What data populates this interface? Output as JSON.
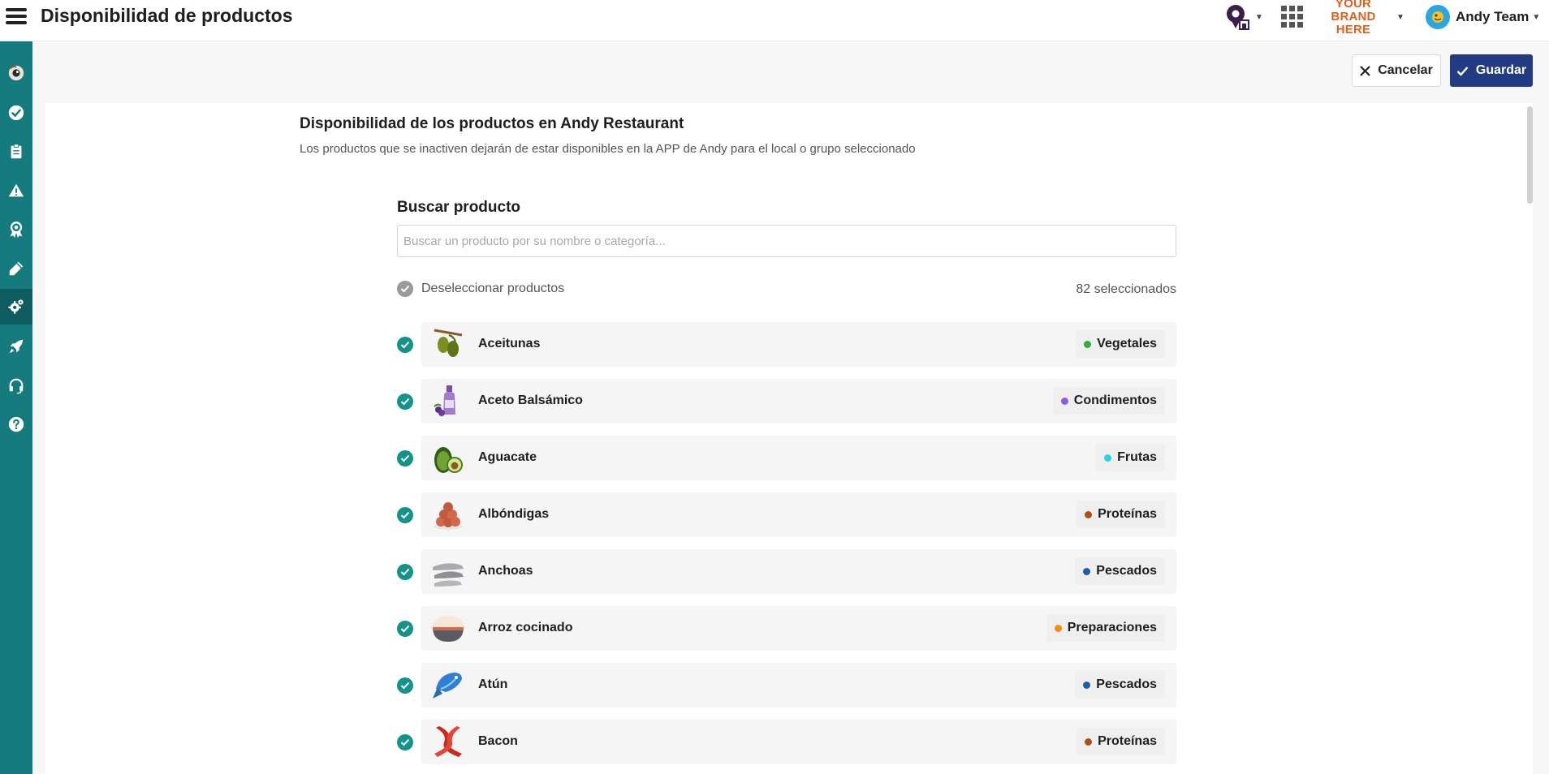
{
  "header": {
    "title": "Disponibilidad de productos",
    "brand_line1": "YOUR BRAND",
    "brand_line2": "HERE",
    "user_name": "Andy Team"
  },
  "actions": {
    "cancel_label": "Cancelar",
    "save_label": "Guardar"
  },
  "section": {
    "title": "Disponibilidad de los productos en Andy Restaurant",
    "subtitle": "Los productos que se inactiven dejarán de estar disponibles en la APP de Andy para el local o grupo seleccionado"
  },
  "search": {
    "label": "Buscar producto",
    "placeholder": "Buscar un producto por su nombre o categoría...",
    "value": ""
  },
  "selection": {
    "deselect_label": "Deseleccionar productos",
    "count_label": "82 seleccionados"
  },
  "sidebar": {
    "items": [
      "eye-logo-icon",
      "check-circle-icon",
      "clipboard-icon",
      "warning-icon",
      "award-icon",
      "pencil-icon",
      "gears-icon",
      "rocket-icon",
      "headset-icon",
      "help-icon"
    ],
    "active_item": "gears-icon"
  },
  "colors": {
    "sidebar": "#157b7e",
    "save_button": "#233b82",
    "check": "#14938a",
    "brand": "#e0611b"
  },
  "products": [
    {
      "name": "Aceitunas",
      "category": "Vegetales",
      "dot": "#2eae3a",
      "icon": "olives"
    },
    {
      "name": "Aceto Balsámico",
      "category": "Condimentos",
      "dot": "#8e5be8",
      "icon": "vinegar-bottle"
    },
    {
      "name": "Aguacate",
      "category": "Frutas",
      "dot": "#2ad3df",
      "icon": "avocado"
    },
    {
      "name": "Albóndigas",
      "category": "Proteínas",
      "dot": "#b04f15",
      "icon": "meatballs"
    },
    {
      "name": "Anchoas",
      "category": "Pescados",
      "dot": "#1c5fa6",
      "icon": "anchovies"
    },
    {
      "name": "Arroz cocinado",
      "category": "Preparaciones",
      "dot": "#f28c12",
      "icon": "rice-bowl"
    },
    {
      "name": "Atún",
      "category": "Pescados",
      "dot": "#1c5fa6",
      "icon": "tuna"
    },
    {
      "name": "Bacon",
      "category": "Proteínas",
      "dot": "#b04f15",
      "icon": "bacon"
    }
  ]
}
